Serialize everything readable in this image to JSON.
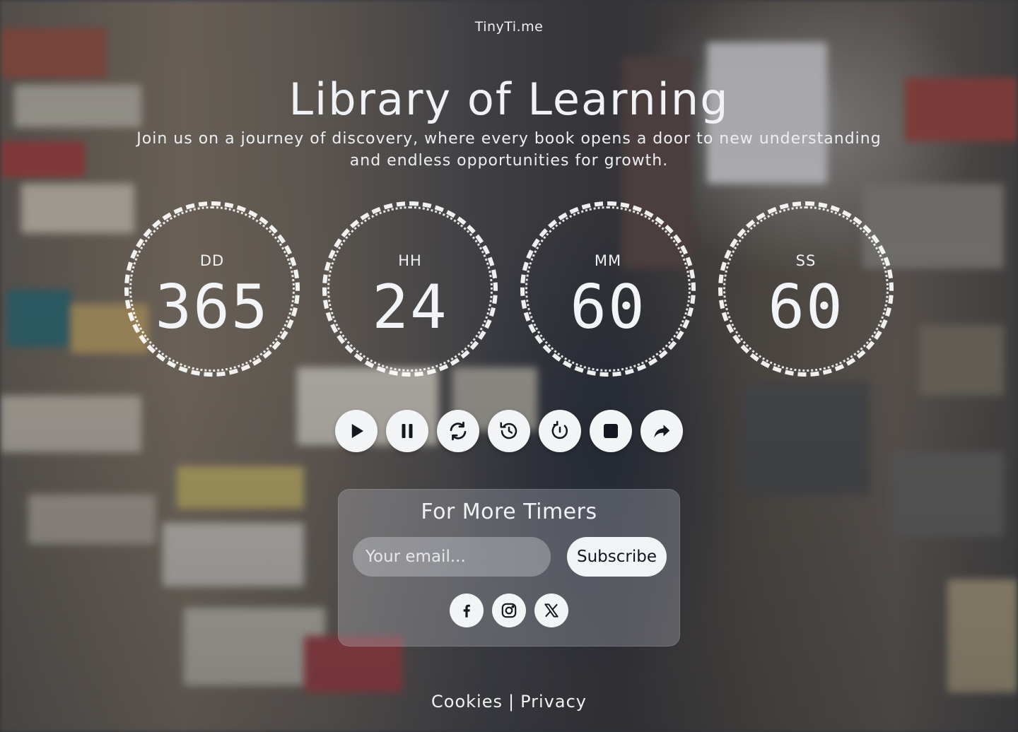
{
  "brand": "TinyTi.me",
  "hero": {
    "title": "Library of Learning",
    "subtitle": "Join us on a journey of discovery, where every book opens a door to new understanding and endless opportunities for growth."
  },
  "countdown": [
    {
      "label": "DD",
      "value": "365"
    },
    {
      "label": "HH",
      "value": "24"
    },
    {
      "label": "MM",
      "value": "60"
    },
    {
      "label": "SS",
      "value": "60"
    }
  ],
  "controls": [
    {
      "name": "play-button",
      "icon": "play-icon"
    },
    {
      "name": "pause-button",
      "icon": "pause-icon"
    },
    {
      "name": "restart-button",
      "icon": "refresh-icon"
    },
    {
      "name": "history-button",
      "icon": "history-icon"
    },
    {
      "name": "reset-button",
      "icon": "reset-icon"
    },
    {
      "name": "stop-button",
      "icon": "stop-icon"
    },
    {
      "name": "share-button",
      "icon": "share-icon"
    }
  ],
  "subscribe": {
    "title": "For More Timers",
    "email_placeholder": "Your email...",
    "button_label": "Subscribe"
  },
  "socials": [
    {
      "name": "facebook",
      "icon": "facebook-icon"
    },
    {
      "name": "instagram",
      "icon": "instagram-icon"
    },
    {
      "name": "x",
      "icon": "x-icon"
    }
  ],
  "footer": {
    "cookies": "Cookies",
    "separator": "|",
    "privacy": "Privacy"
  },
  "colors": {
    "text": "#f1f2f5",
    "button_bg": "#f3f4f6",
    "icon": "#14171f"
  }
}
